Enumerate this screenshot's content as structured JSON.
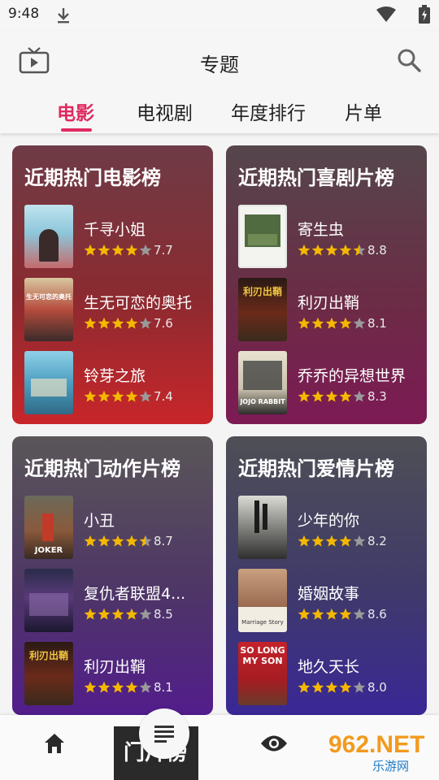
{
  "status_bar": {
    "time": "9:48"
  },
  "header": {
    "title": "专题"
  },
  "tabs": [
    {
      "label": "电影",
      "active": true
    },
    {
      "label": "电视剧",
      "active": false
    },
    {
      "label": "年度排行",
      "active": false
    },
    {
      "label": "片单",
      "active": false
    }
  ],
  "cards": [
    {
      "title": "近期热门电影榜",
      "items": [
        {
          "title": "千寻小姐",
          "rating": "7.7",
          "stars": 4
        },
        {
          "title": "生无可恋的奥托",
          "rating": "7.6",
          "stars": 4
        },
        {
          "title": "铃芽之旅",
          "rating": "7.4",
          "stars": 4
        }
      ]
    },
    {
      "title": "近期热门喜剧片榜",
      "items": [
        {
          "title": "寄生虫",
          "rating": "8.8",
          "stars": 4.5
        },
        {
          "title": "利刃出鞘",
          "rating": "8.1",
          "stars": 4
        },
        {
          "title": "乔乔的异想世界",
          "rating": "8.3",
          "stars": 4
        }
      ]
    },
    {
      "title": "近期热门动作片榜",
      "items": [
        {
          "title": "小丑",
          "rating": "8.7",
          "stars": 4.5
        },
        {
          "title": "复仇者联盟4...",
          "rating": "8.5",
          "stars": 4
        },
        {
          "title": "利刃出鞘",
          "rating": "8.1",
          "stars": 4
        }
      ]
    },
    {
      "title": "近期热门爱情片榜",
      "items": [
        {
          "title": "少年的你",
          "rating": "8.2",
          "stars": 4
        },
        {
          "title": "婚姻故事",
          "rating": "8.6",
          "stars": 4
        },
        {
          "title": "地久天长",
          "rating": "8.0",
          "stars": 4
        }
      ]
    }
  ],
  "poster_texts": {
    "jojo": "JOJO RABBIT",
    "joker": "JOKER",
    "so_long": "SO LONG MY SON",
    "marriage": "Marriage Story",
    "otto": "生无可恋的奥托",
    "knives": "利刃出鞘"
  },
  "bottom_nav": {
    "peek_label": "门片榜"
  },
  "watermark": {
    "brand": "962.NET",
    "sub": "乐游网"
  },
  "colors": {
    "accent": "#e0295f",
    "star": "#f5b800",
    "star_empty": "#9a9a9a"
  },
  "icons": [
    "download-icon",
    "wifi-icon",
    "battery-icon",
    "tv-icon",
    "search-icon",
    "star-icon",
    "home-icon",
    "list-icon",
    "eye-icon"
  ]
}
